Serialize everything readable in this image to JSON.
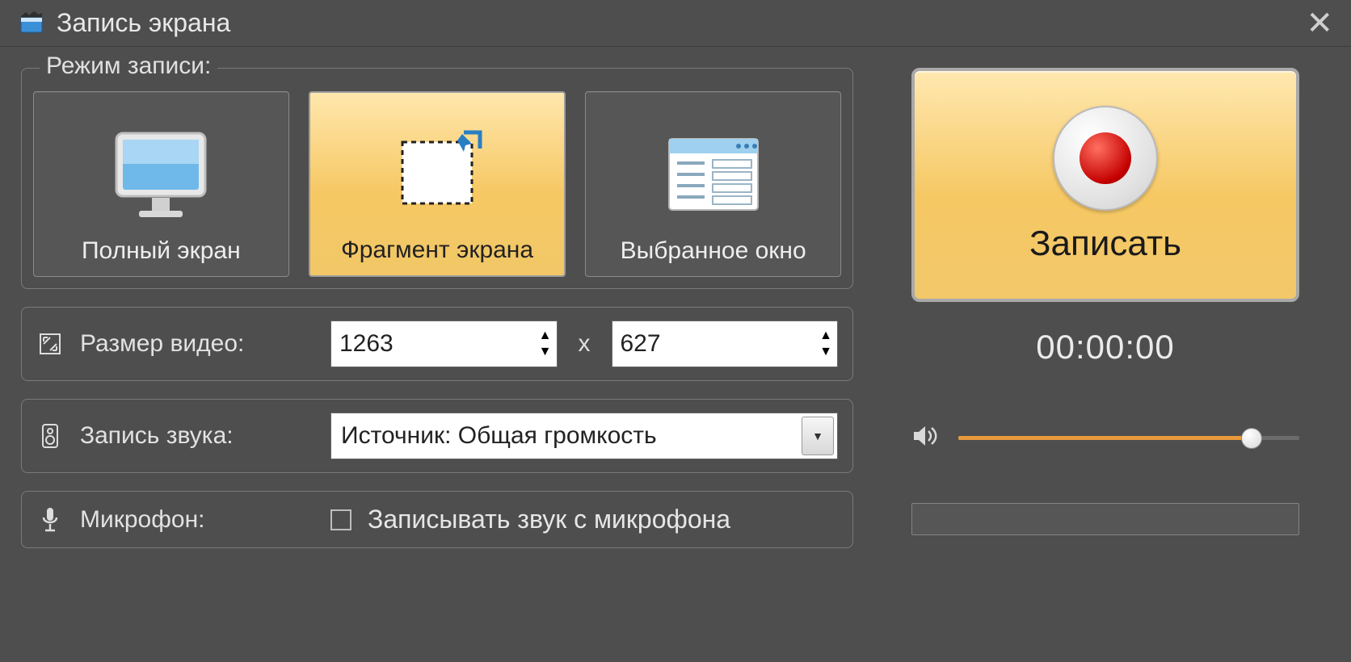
{
  "window": {
    "title": "Запись экрана"
  },
  "modes": {
    "group_label": "Режим записи:",
    "items": [
      {
        "label": "Полный экран"
      },
      {
        "label": "Фрагмент экрана"
      },
      {
        "label": "Выбранное окно"
      }
    ]
  },
  "video_size": {
    "label": "Размер видео:",
    "width": "1263",
    "height": "627",
    "separator": "x"
  },
  "audio": {
    "label": "Запись звука:",
    "selected": "Источник: Общая громкость"
  },
  "mic": {
    "label": "Микрофон:",
    "checkbox_label": "Записывать звук с микрофона"
  },
  "record": {
    "button_label": "Записать",
    "timer": "00:00:00"
  }
}
